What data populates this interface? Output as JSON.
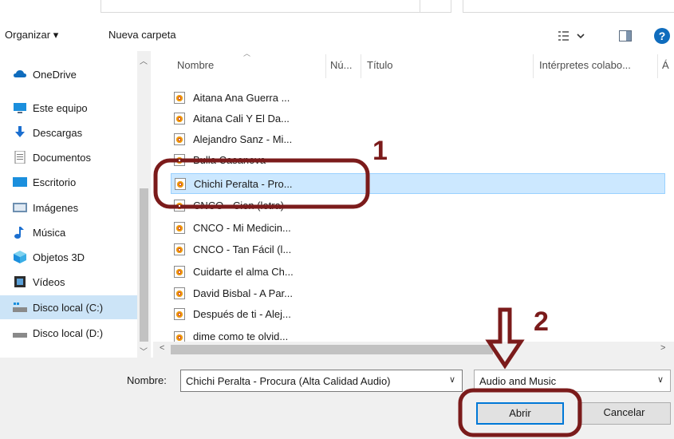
{
  "toolbar": {
    "organize_label": "Organizar ▾",
    "new_folder_label": "Nueva carpeta",
    "help_label": "?"
  },
  "nav": {
    "items": [
      {
        "label": "OneDrive",
        "icon": "cloud-icon"
      },
      {
        "label": "Este equipo",
        "icon": "computer-icon"
      },
      {
        "label": "Descargas",
        "icon": "download-icon"
      },
      {
        "label": "Documentos",
        "icon": "document-icon"
      },
      {
        "label": "Escritorio",
        "icon": "desktop-icon"
      },
      {
        "label": "Imágenes",
        "icon": "picture-icon"
      },
      {
        "label": "Música",
        "icon": "music-icon"
      },
      {
        "label": "Objetos 3D",
        "icon": "cube-icon"
      },
      {
        "label": "Vídeos",
        "icon": "film-icon"
      },
      {
        "label": "Disco local (C:)",
        "icon": "drive-icon"
      },
      {
        "label": "Disco local (D:)",
        "icon": "drive-icon"
      }
    ]
  },
  "files": {
    "columns": [
      "Nombre",
      "Nú...",
      "Título",
      "Intérpretes colabo...",
      "Á"
    ],
    "rows": [
      "Aitana Ana Guerra ...",
      "Aitana Cali Y El Da...",
      "Alejandro Sanz - Mi...",
      "Bulla Casanova",
      "Chichi Peralta - Pro...",
      "CNCO - Cien (letra)",
      "CNCO - Mi Medicin...",
      "CNCO - Tan Fácil (l...",
      "Cuidarte el alma Ch...",
      "David Bisbal - A Par...",
      "Después de ti - Alej...",
      "dime como te olvid..."
    ],
    "selected_index": 4
  },
  "bottom": {
    "name_label": "Nombre:",
    "name_value": "Chichi Peralta - Procura (Alta Calidad Audio)",
    "type_value": "Audio and Music",
    "open_label": "Abrir",
    "cancel_label": "Cancelar"
  },
  "annotations": {
    "step1": "1",
    "step2": "2",
    "color": "#7b1b1b"
  }
}
